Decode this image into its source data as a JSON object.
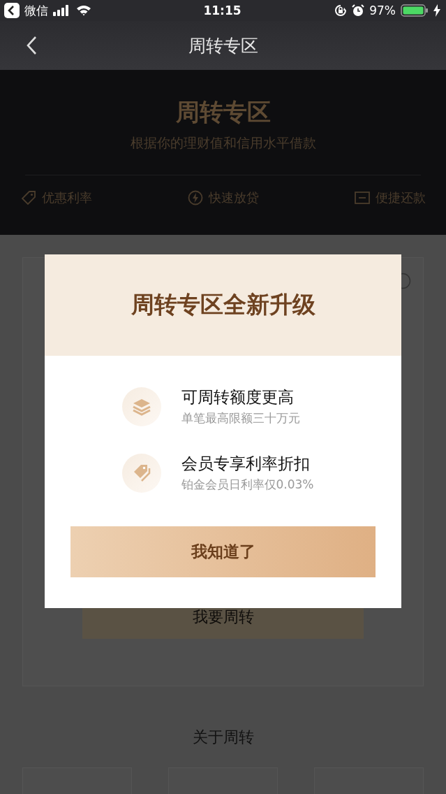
{
  "status_bar": {
    "back_app": "微信",
    "time": "11:15",
    "battery": "97%"
  },
  "nav": {
    "title": "周转专区"
  },
  "hero": {
    "title": "周转专区",
    "subtitle": "根据你的理财值和信用水平借款",
    "features": [
      {
        "kind": "tag",
        "label": "优惠利率"
      },
      {
        "kind": "bolt",
        "label": "快速放贷"
      },
      {
        "kind": "card",
        "label": "便捷还款"
      }
    ]
  },
  "main_card": {
    "button": "我要周转"
  },
  "about": {
    "title": "关于周转"
  },
  "dialog": {
    "title": "周转专区全新升级",
    "items": [
      {
        "kind": "layers",
        "title": "可周转额度更高",
        "subtitle": "单笔最高限额三十万元"
      },
      {
        "kind": "tag",
        "title": "会员专享利率折扣",
        "subtitle": "铂金会员日利率仅0.03%"
      }
    ],
    "button": "我知道了"
  }
}
